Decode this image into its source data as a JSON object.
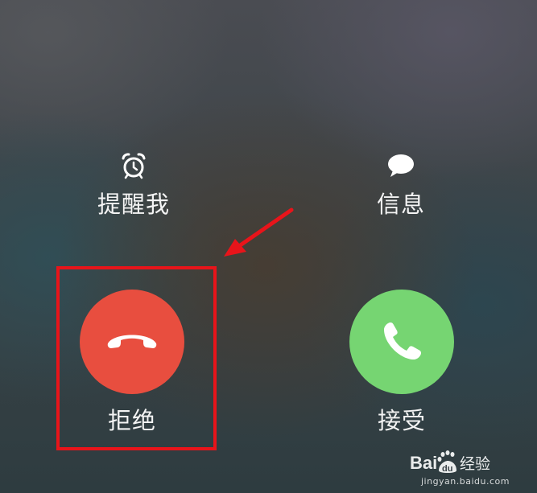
{
  "incoming_call": {
    "remind_option": {
      "label": "提醒我",
      "icon": "alarm-clock-icon"
    },
    "message_option": {
      "label": "信息",
      "icon": "chat-bubble-icon"
    },
    "decline": {
      "label": "拒绝",
      "icon": "phone-hangup-icon",
      "color": "#e84e3f"
    },
    "accept": {
      "label": "接受",
      "icon": "phone-icon",
      "color": "#76d572"
    }
  },
  "annotation": {
    "highlight_color": "#e8141a",
    "arrow_icon": "arrow-icon"
  },
  "watermark": {
    "logo_text": "Baidu经验",
    "url": "jingyan.baidu.com"
  }
}
